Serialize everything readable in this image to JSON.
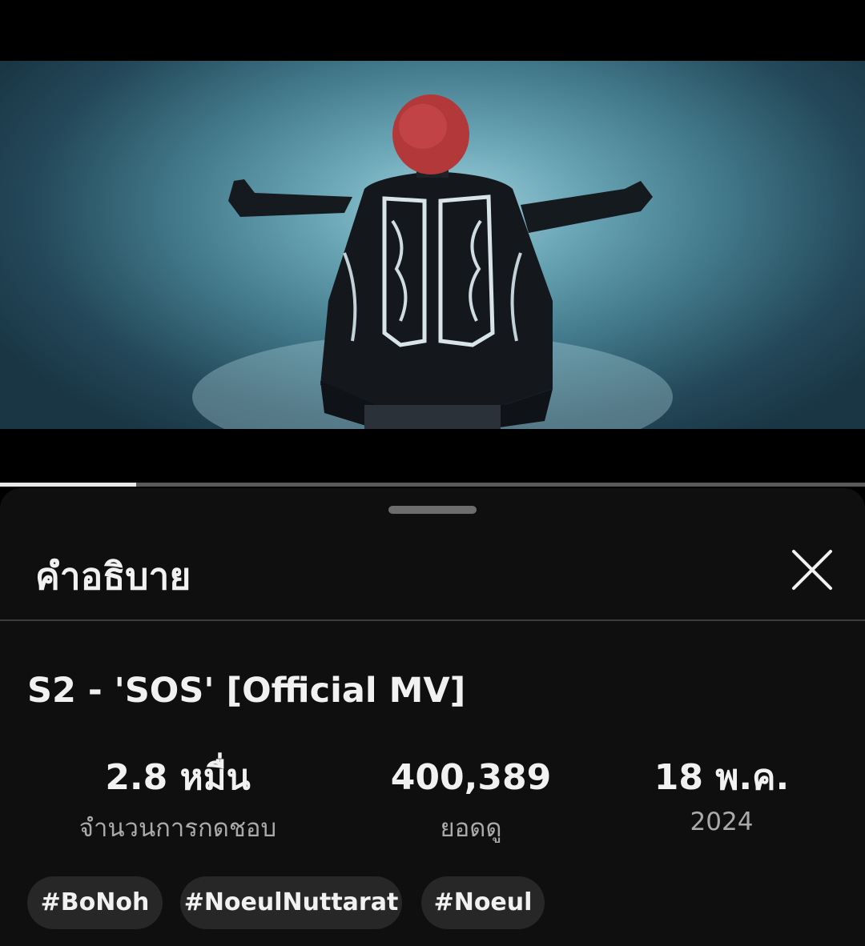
{
  "player": {
    "progress_fraction": 0.157
  },
  "panel": {
    "title": "คำอธิบาย",
    "close_icon": "close-icon"
  },
  "video": {
    "title": "S2  - 'SOS' [Official MV]",
    "stats": [
      {
        "value": "2.8 หมื่น",
        "label": "จำนวนการกดชอบ"
      },
      {
        "value": "400,389",
        "label": "ยอดดู"
      },
      {
        "value": "18 พ.ค.",
        "label": "2024"
      }
    ],
    "hashtags": [
      "#BoNoh",
      "#NoeulNuttarat",
      "#Noeul"
    ]
  },
  "colors": {
    "sheet_background": "#0f0f0f",
    "chip_background": "#272727",
    "secondary_text": "#aaaaaa"
  }
}
